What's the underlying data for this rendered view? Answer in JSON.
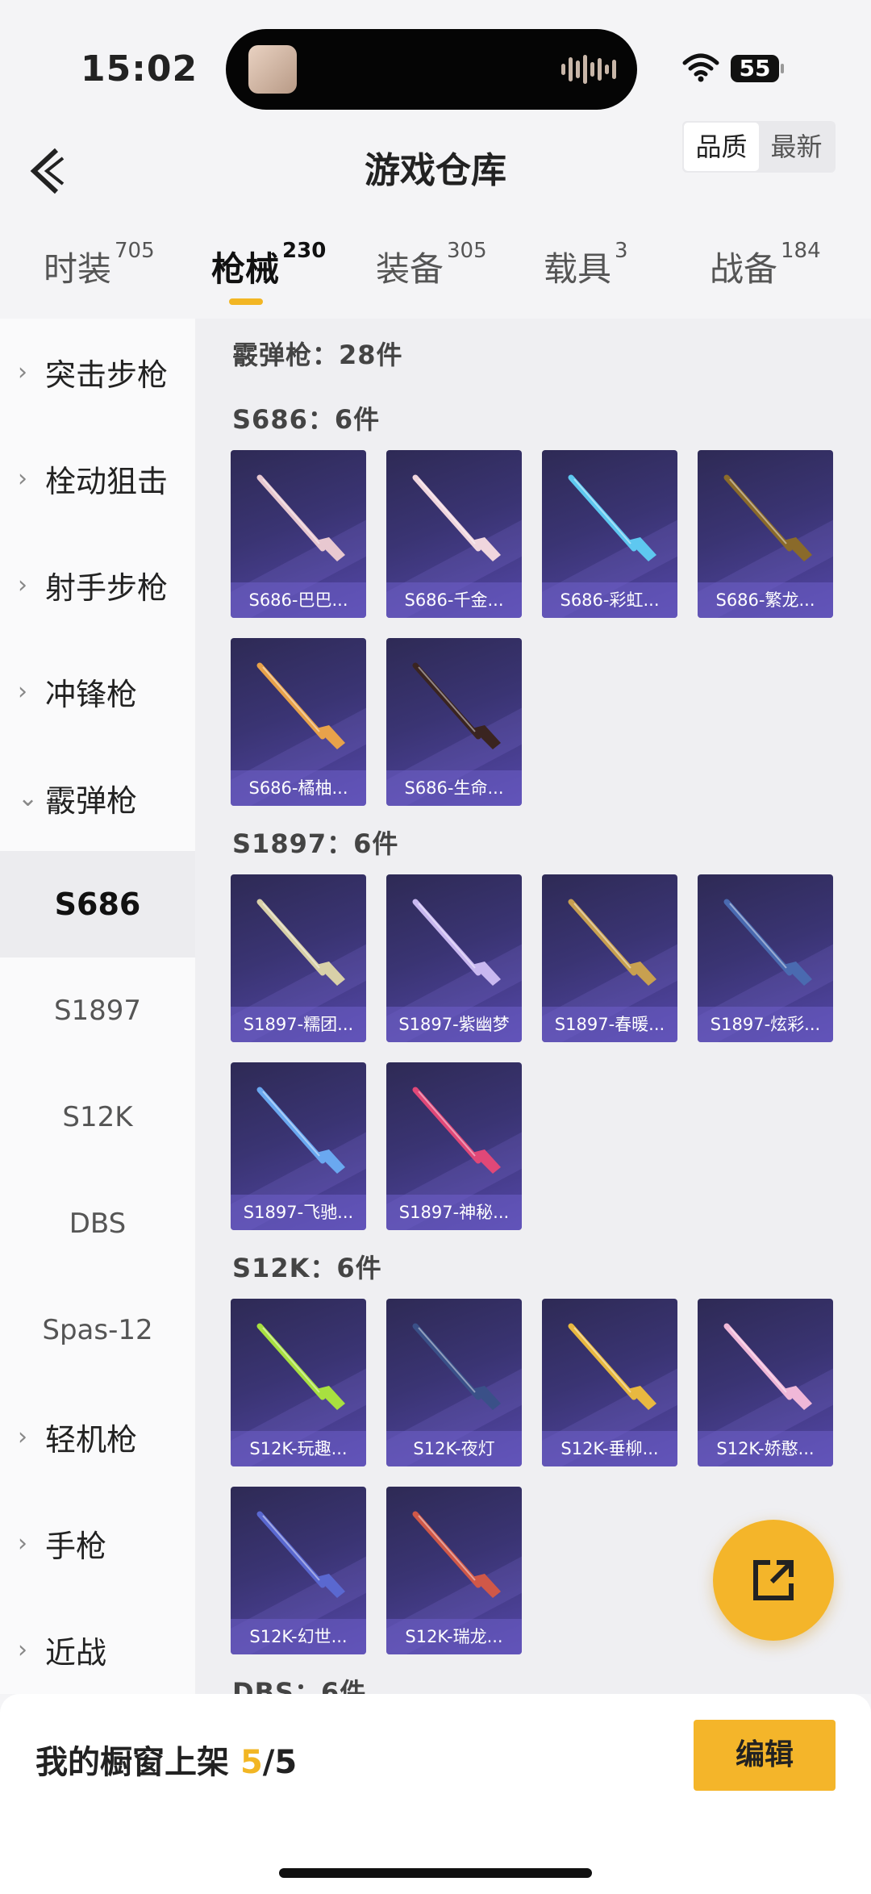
{
  "status_bar": {
    "time": "15:02",
    "battery": "55"
  },
  "header": {
    "title": "游戏仓库",
    "sort_options": [
      "品质",
      "最新"
    ]
  },
  "tabs": [
    {
      "label": "时装",
      "count": "705"
    },
    {
      "label": "枪械",
      "count": "230"
    },
    {
      "label": "装备",
      "count": "305"
    },
    {
      "label": "载具",
      "count": "3"
    },
    {
      "label": "战备",
      "count": "184"
    }
  ],
  "sidebar": {
    "categories": [
      {
        "label": "突击步枪"
      },
      {
        "label": "栓动狙击"
      },
      {
        "label": "射手步枪"
      },
      {
        "label": "冲锋枪"
      },
      {
        "label": "霰弹枪"
      },
      {
        "label": "S686"
      },
      {
        "label": "S1897"
      },
      {
        "label": "S12K"
      },
      {
        "label": "DBS"
      },
      {
        "label": "Spas-12"
      },
      {
        "label": "轻机枪"
      },
      {
        "label": "手枪"
      },
      {
        "label": "近战"
      }
    ]
  },
  "content": {
    "category_heading": "霰弹枪：28件",
    "sections": [
      {
        "heading": "S686：6件",
        "items": [
          "S686-巴巴...",
          "S686-千金...",
          "S686-彩虹...",
          "S686-繁龙...",
          "S686-橘柚...",
          "S686-生命..."
        ]
      },
      {
        "heading": "S1897：6件",
        "items": [
          "S1897-糯团...",
          "S1897-紫幽梦",
          "S1897-春暖...",
          "S1897-炫彩...",
          "S1897-飞驰...",
          "S1897-神秘..."
        ]
      },
      {
        "heading": "S12K：6件",
        "items": [
          "S12K-玩趣...",
          "S12K-夜灯",
          "S12K-垂柳...",
          "S12K-娇憨...",
          "S12K-幻世...",
          "S12K-瑞龙..."
        ]
      },
      {
        "heading": "DBS：6件",
        "items": []
      }
    ],
    "skin_colors": [
      "#e8c8d0",
      "#f0d6de",
      "#5ec8f0",
      "#8a6a2a",
      "#e8a24a",
      "#3a2420",
      "#d8d0a8",
      "#c9b8f0",
      "#c8a050",
      "#4a6ab0",
      "#6aa8f0",
      "#e04878",
      "#a8e040",
      "#3a5088",
      "#e8b840",
      "#f0b8d8",
      "#5a68d0",
      "#d05848"
    ]
  },
  "bottom_bar": {
    "shelf_label": "我的橱窗上架",
    "shelf_current": "5",
    "shelf_total": "/5",
    "edit_label": "编辑"
  }
}
